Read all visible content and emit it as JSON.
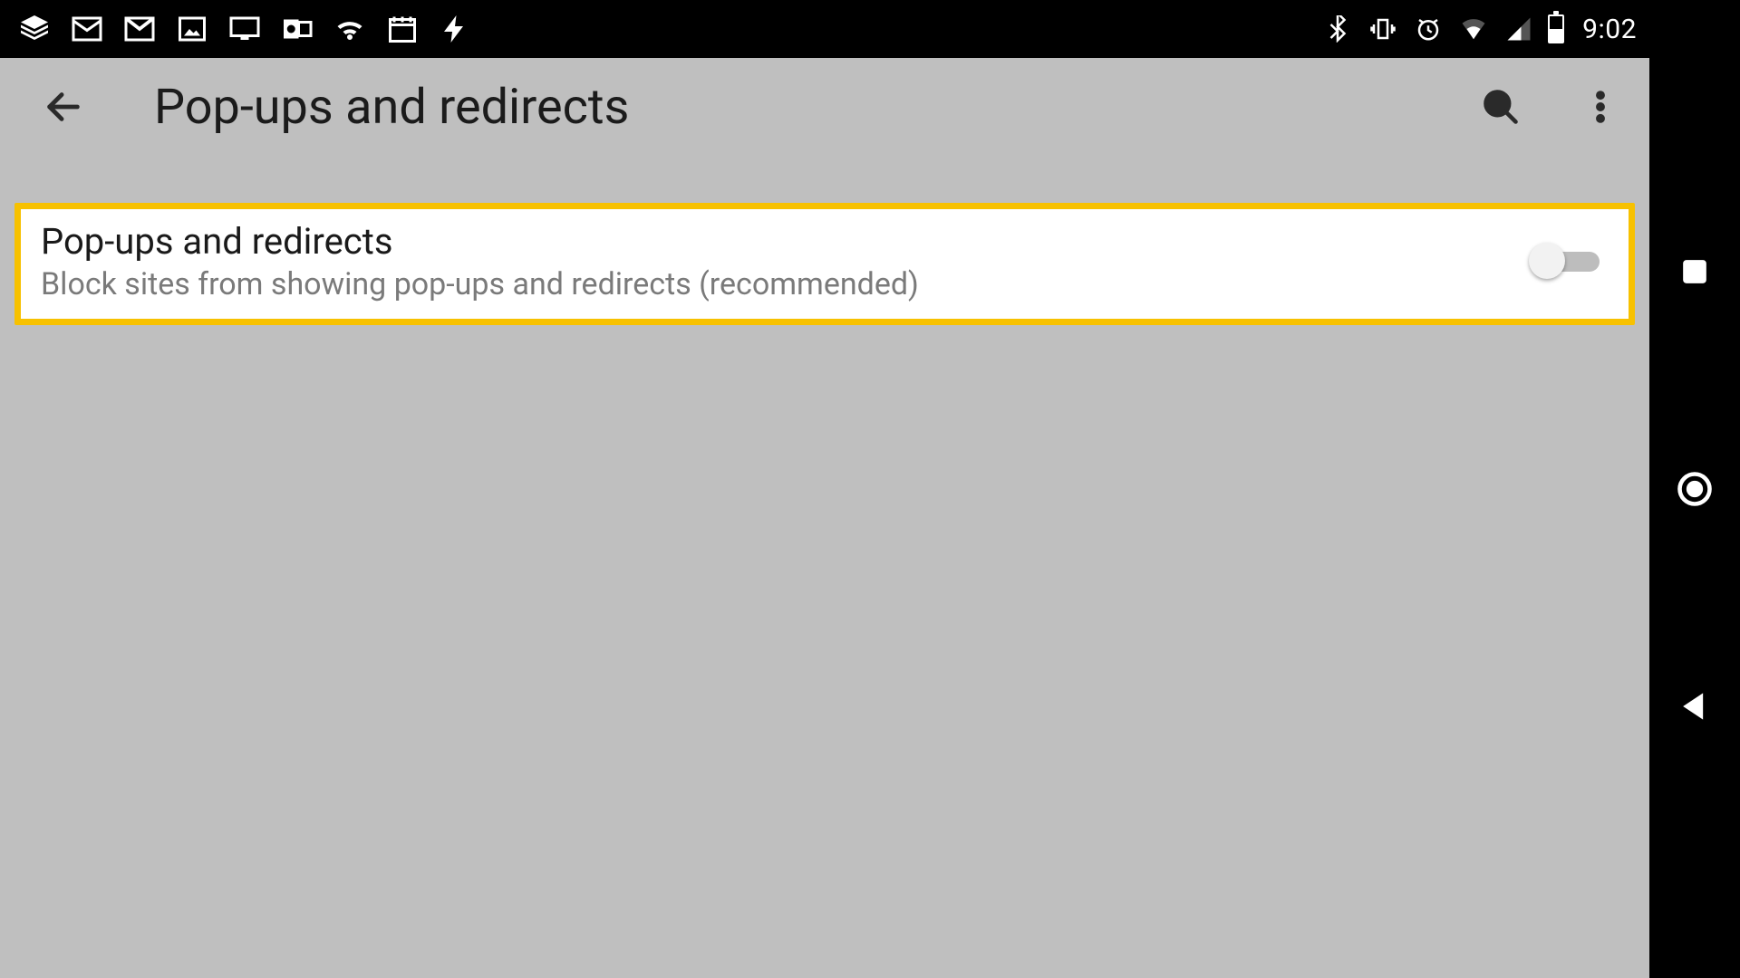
{
  "status_bar": {
    "clock": "9:02",
    "left_icons": [
      "layers-icon",
      "mail-icon",
      "gmail-icon",
      "image-icon",
      "monitor-icon",
      "outlook-icon",
      "wifi-icon",
      "calendar-icon",
      "flash-icon"
    ],
    "right_icons": [
      "bluetooth-icon",
      "vibrate-icon",
      "alarm-icon",
      "wifi-signal-icon",
      "cell-signal-icon",
      "battery-icon"
    ]
  },
  "app_bar": {
    "title": "Pop-ups and redirects"
  },
  "settings": {
    "popups": {
      "title": "Pop-ups and redirects",
      "subtitle": "Block sites from showing pop-ups and redirects (recommended)",
      "enabled": false
    }
  },
  "highlight_color": "#f7c100"
}
